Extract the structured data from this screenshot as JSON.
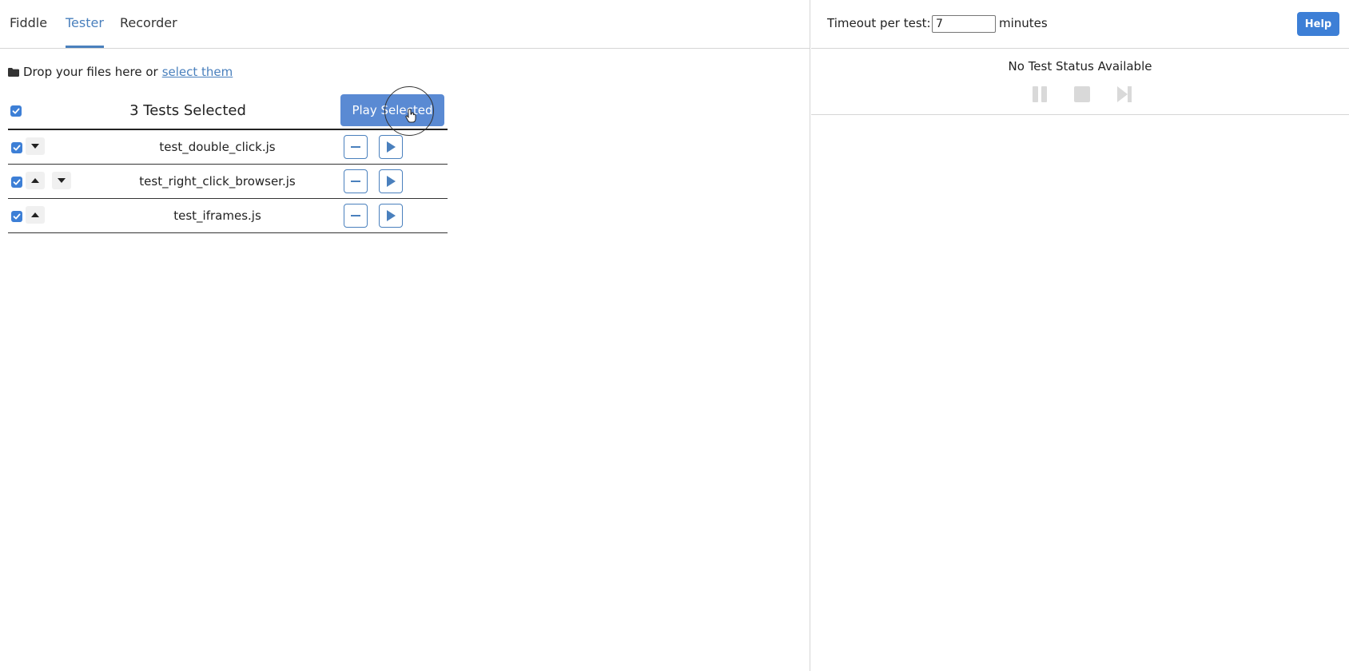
{
  "tabs": [
    {
      "label": "Fiddle",
      "active": false
    },
    {
      "label": "Tester",
      "active": true
    },
    {
      "label": "Recorder",
      "active": false
    }
  ],
  "dropzone": {
    "text": "Drop your files here or",
    "link": "select them",
    "icon": "folder-icon"
  },
  "tests": {
    "header_title": "3 Tests Selected",
    "play_selected_label": "Play Selected",
    "all_checked": true,
    "rows": [
      {
        "name": "test_double_click.js",
        "checked": true,
        "can_move_up": false,
        "can_move_down": true
      },
      {
        "name": "test_right_click_browser.js",
        "checked": true,
        "can_move_up": true,
        "can_move_down": true
      },
      {
        "name": "test_iframes.js",
        "checked": true,
        "can_move_up": true,
        "can_move_down": false
      }
    ]
  },
  "runner": {
    "timeout_label": "Timeout per test:",
    "timeout_value": "7",
    "timeout_unit": "minutes",
    "help_label": "Help",
    "status_text": "No Test Status Available",
    "controls": [
      "pause-icon",
      "stop-icon",
      "skip-next-icon"
    ]
  },
  "colors": {
    "accent": "#4a80bd",
    "button_blue": "#5a8ad3",
    "checkbox_blue": "#3d7fd6",
    "disabled_control": "#d9d9d9"
  }
}
